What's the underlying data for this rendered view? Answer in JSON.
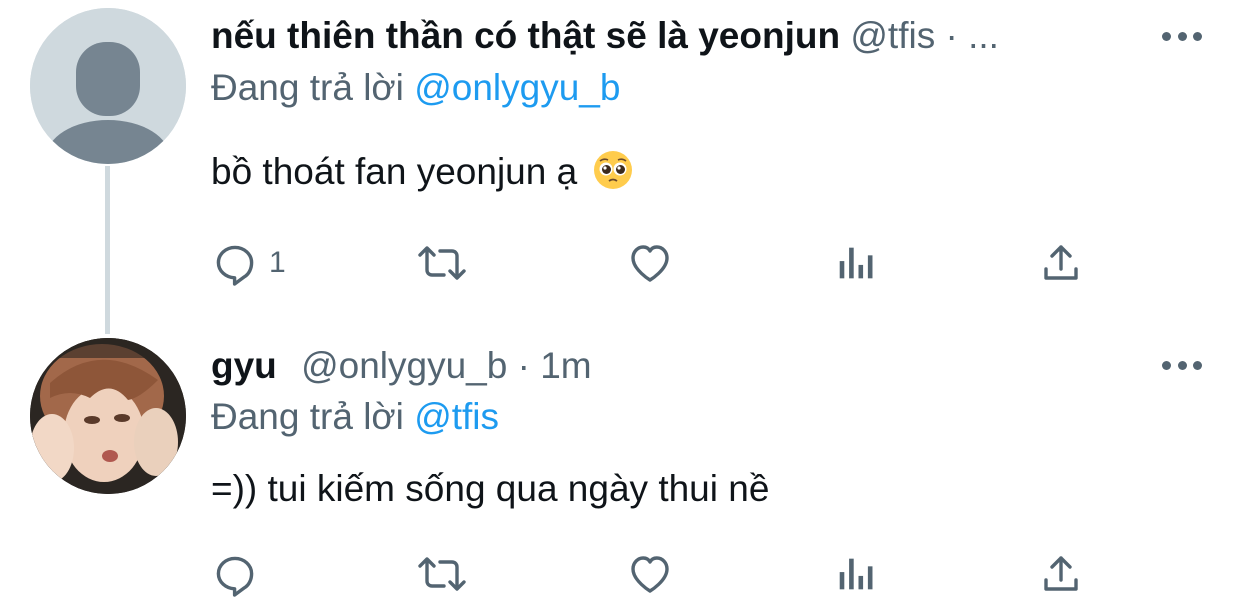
{
  "tweets": [
    {
      "display_name": "nếu thiên thần có thật sẽ là yeonjun",
      "handle_meta": "@tfis · ...",
      "reply_prefix": "Đang trả lời",
      "reply_to": "@onlygyu_b",
      "text": "bồ thoát fan yeonjun ạ",
      "emoji": "pleading-face-emoji",
      "reply_count": "1",
      "avatar": "default-avatar"
    },
    {
      "display_name": "gyu",
      "handle_meta": "@onlygyu_b · 1m",
      "reply_prefix": "Đang trả lời",
      "reply_to": "@tfis",
      "text": "=)) tui kiếm sống qua ngày thui nề",
      "reply_count": "",
      "avatar": "photo-avatar"
    }
  ],
  "icons": [
    "reply-icon",
    "retweet-icon",
    "like-icon",
    "analytics-icon",
    "share-icon",
    "more-icon"
  ],
  "colors": {
    "text": "#0f1419",
    "secondary": "#536471",
    "link": "#1d9bf0",
    "thread_line": "#cfd9de"
  }
}
